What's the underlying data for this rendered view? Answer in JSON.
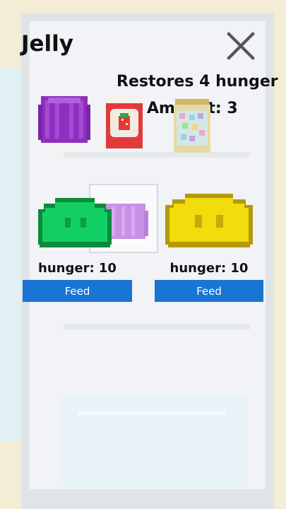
{
  "title": "Jelly",
  "item_info": {
    "description": "Restores 4 hunger",
    "amount_text": "Amount: 3"
  },
  "inventory": [
    {
      "name": "Jelly",
      "icon": "jelly-icon"
    },
    {
      "name": "Jam",
      "icon": "jam-jar-icon"
    },
    {
      "name": "Candy bag",
      "icon": "candy-bag-icon"
    }
  ],
  "pets": [
    {
      "color": "#12cf63",
      "hunger_label": "hunger: 10",
      "feed_label": "Feed"
    },
    {
      "color": "#f1dc0c",
      "hunger_label": "hunger: 10",
      "feed_label": "Feed"
    }
  ],
  "colors": {
    "feed_button": "#1a74d3",
    "jelly": "#8f2fbf"
  }
}
